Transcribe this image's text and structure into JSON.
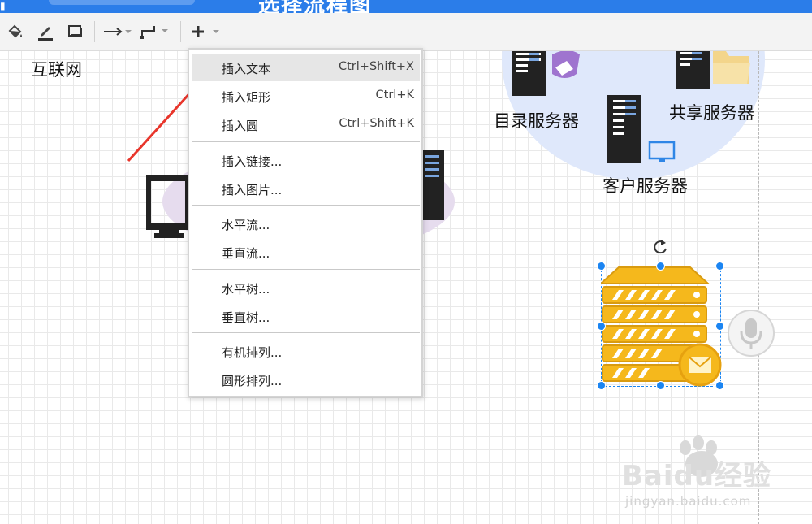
{
  "app": {
    "title": "选择流程图"
  },
  "toolbar": {
    "items": [
      {
        "name": "fill-color-icon"
      },
      {
        "name": "line-color-icon"
      },
      {
        "name": "shadow-icon"
      },
      {
        "name": "connection-arrow-icon"
      },
      {
        "name": "waypoint-elbow-icon"
      },
      {
        "name": "insert-plus-icon"
      }
    ]
  },
  "canvas": {
    "labels": {
      "internet": "互联网",
      "directory_server": "目录服务器",
      "shared_server": "共享服务器",
      "client_server": "客户服务器"
    }
  },
  "context_menu": {
    "items": [
      {
        "label": "插入文本",
        "shortcut": "Ctrl+Shift+X",
        "highlighted": true
      },
      {
        "label": "插入矩形",
        "shortcut": "Ctrl+K"
      },
      {
        "label": "插入圆",
        "shortcut": "Ctrl+Shift+K"
      },
      {
        "label": "插入链接..."
      },
      {
        "label": "插入图片..."
      },
      {
        "label": "水平流..."
      },
      {
        "label": "垂直流..."
      },
      {
        "label": "水平树..."
      },
      {
        "label": "垂直树..."
      },
      {
        "label": "有机排列..."
      },
      {
        "label": "圆形排列..."
      }
    ]
  },
  "watermark": {
    "brand": "Baidu经验",
    "url": "jingyan.baidu.com"
  },
  "colors": {
    "accent": "#2b7de9",
    "selection": "#1b85f2",
    "server_gold": "#f5b81c",
    "annotation_arrow": "#e8352b"
  }
}
